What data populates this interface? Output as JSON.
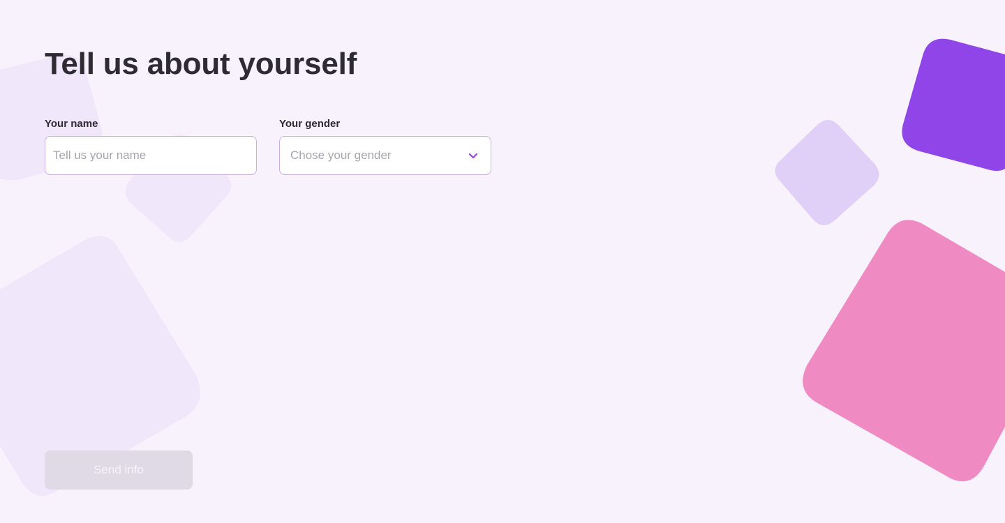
{
  "page": {
    "title": "Tell us about yourself"
  },
  "form": {
    "name_field": {
      "label": "Your name",
      "value": "",
      "placeholder": "Tell us your name"
    },
    "gender_field": {
      "label": "Your gender",
      "selected_value": "Chose your gender",
      "icon": "chevron-down-icon"
    },
    "submit": {
      "label": "Send info",
      "state": "disabled"
    }
  },
  "colors": {
    "background": "#f8f2fd",
    "title_text": "#2e2b33",
    "input_border": "#c8aee6",
    "placeholder_text": "#a8a4ad",
    "accent_purple": "#8f45e7",
    "accent_pink": "#f08ac3",
    "light_lavender": "#e0cff6",
    "faint_lavender": "#f0e7fb",
    "button_disabled_bg": "#e0d9e6",
    "button_disabled_text": "#f7f3fa"
  }
}
